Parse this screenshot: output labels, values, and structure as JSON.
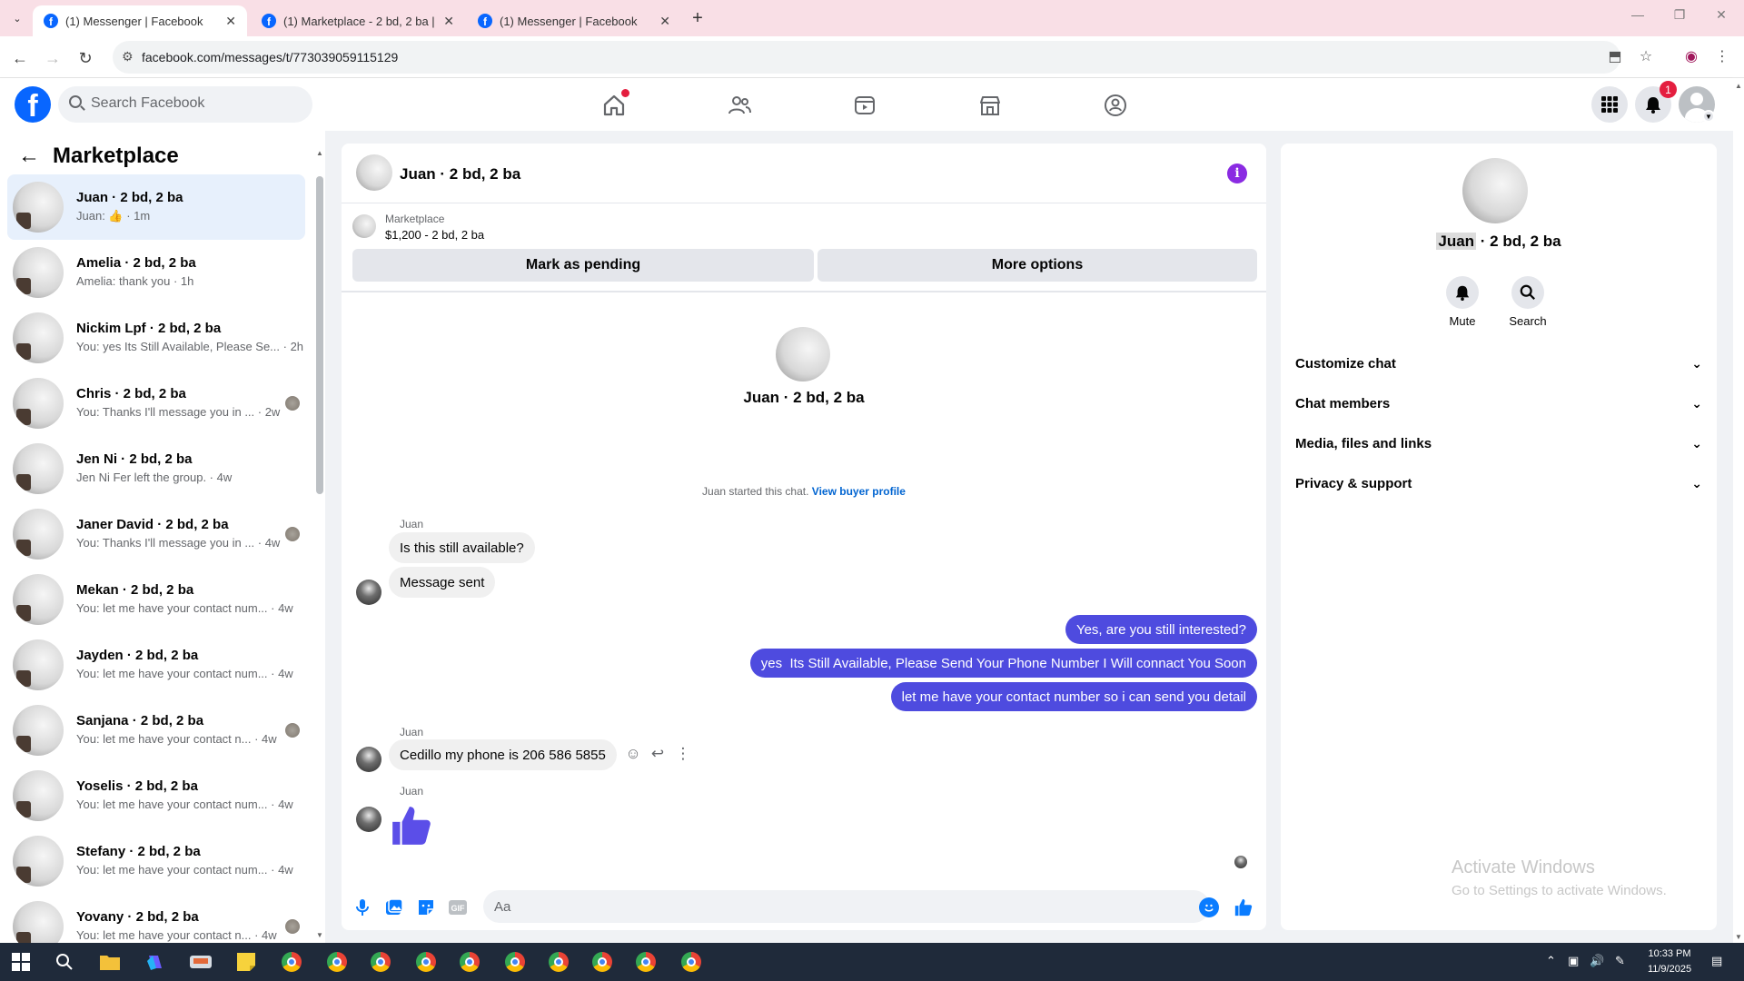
{
  "browser": {
    "tabs": [
      {
        "title": "(1) Messenger | Facebook",
        "active": true
      },
      {
        "title": "(1) Marketplace - 2 bd, 2 ba | Fa",
        "active": false
      },
      {
        "title": "(1) Messenger | Facebook",
        "active": false
      }
    ],
    "url": "facebook.com/messages/t/773039059115129"
  },
  "fb_nav": {
    "search_placeholder": "Search Facebook",
    "notifications_count": "1"
  },
  "sidebar": {
    "title": "Marketplace",
    "conversations": [
      {
        "name": "Juan · 2 bd, 2 ba",
        "preview": "Juan: 👍 · 1m",
        "active": true
      },
      {
        "name": "Amelia · 2 bd, 2 ba",
        "preview": "Amelia: thank you · 1h"
      },
      {
        "name": "Nickim Lpf · 2 bd, 2 ba",
        "preview": "You: yes Its Still Available, Please Se... · 2h"
      },
      {
        "name": "Chris · 2 bd, 2 ba",
        "preview": "You: Thanks I'll message you in ... · 2w",
        "seen": true
      },
      {
        "name": "Jen Ni · 2 bd, 2 ba",
        "preview": "Jen Ni Fer left the group. · 4w"
      },
      {
        "name": "Janer David · 2 bd, 2 ba",
        "preview": "You: Thanks I'll message you in ... · 4w",
        "seen": true
      },
      {
        "name": "Mekan · 2 bd, 2 ba",
        "preview": "You: let me have your contact num... · 4w"
      },
      {
        "name": "Jayden · 2 bd, 2 ba",
        "preview": "You: let me have your contact num... · 4w"
      },
      {
        "name": "Sanjana · 2 bd, 2 ba",
        "preview": "You: let me have your contact n... · 4w",
        "seen": true
      },
      {
        "name": "Yoselis · 2 bd, 2 ba",
        "preview": "You: let me have your contact num... · 4w"
      },
      {
        "name": "Stefany · 2 bd, 2 ba",
        "preview": "You: let me have your contact num... · 4w"
      },
      {
        "name": "Yovany · 2 bd, 2 ba",
        "preview": "You: let me have your contact n... · 4w",
        "seen": true
      }
    ]
  },
  "chat": {
    "title": "Juan · 2 bd, 2 ba",
    "listing": {
      "label": "Marketplace",
      "price": "$1,200 - 2 bd, 2 ba",
      "mark_pending": "Mark as pending",
      "more_options": "More options"
    },
    "intro_name": "Juan · 2 bd, 2 ba",
    "started_text": "Juan started this chat.",
    "view_buyer_profile": "View buyer profile",
    "sender_name": "Juan",
    "messages_in_1": [
      "Is this still available?",
      "Message sent"
    ],
    "messages_out": [
      "Yes, are you still interested?",
      "yes  Its Still Available, Please Send Your Phone Number I Will connact You Soon",
      "let me have your contact number so i can send you detail"
    ],
    "message_in_2": "Cedillo my phone is  206 586 5855",
    "composer_placeholder": "Aa"
  },
  "info_panel": {
    "name_highlight": "Juan",
    "name_rest": " · 2 bd, 2 ba",
    "actions": [
      {
        "label": "Mute"
      },
      {
        "label": "Search"
      }
    ],
    "sections": [
      "Customize chat",
      "Chat members",
      "Media, files and links",
      "Privacy & support"
    ],
    "watermark_title": "Activate Windows",
    "watermark_sub": "Go to Settings to activate Windows."
  },
  "taskbar": {
    "time": "10:33 PM",
    "date": "11/9/2025"
  },
  "colors": {
    "fb_blue": "#0866ff",
    "outgoing_bubble": "#4e4bdf",
    "like_blue": "#0a7cff",
    "thumbs_purple": "#5b4ee8"
  }
}
